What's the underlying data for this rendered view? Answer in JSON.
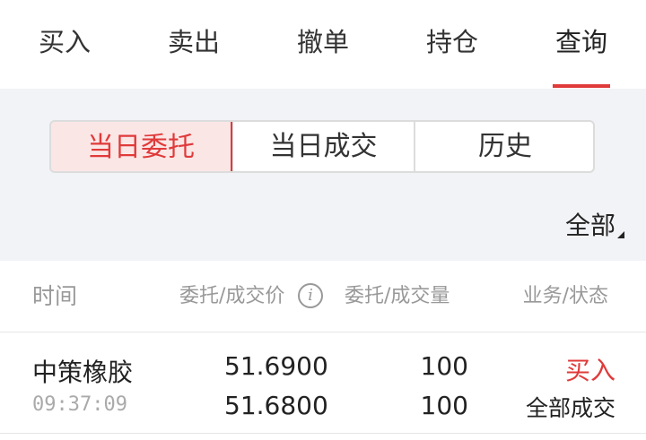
{
  "nav": {
    "tabs": [
      {
        "label": "买入"
      },
      {
        "label": "卖出"
      },
      {
        "label": "撤单"
      },
      {
        "label": "持仓"
      },
      {
        "label": "查询"
      }
    ],
    "active_tab": "查询"
  },
  "filters": {
    "segments": [
      {
        "label": "当日委托"
      },
      {
        "label": "当日成交"
      },
      {
        "label": "历史"
      }
    ],
    "active_segment": "当日委托",
    "scope_label": "全部"
  },
  "table": {
    "headers": {
      "time": "时间",
      "price": "委托/成交价",
      "quantity": "委托/成交量",
      "status": "业务/状态"
    },
    "info_icon": "i",
    "rows": [
      {
        "name": "中策橡胶",
        "time": "09:37:09",
        "order_price": "51.6900",
        "deal_price": "51.6800",
        "order_qty": "100",
        "deal_qty": "100",
        "side": "买入",
        "status": "全部成交"
      }
    ]
  },
  "colors": {
    "accent": "#e03a3a",
    "panel_bg": "#f2f3f7",
    "muted_text": "#999999"
  }
}
